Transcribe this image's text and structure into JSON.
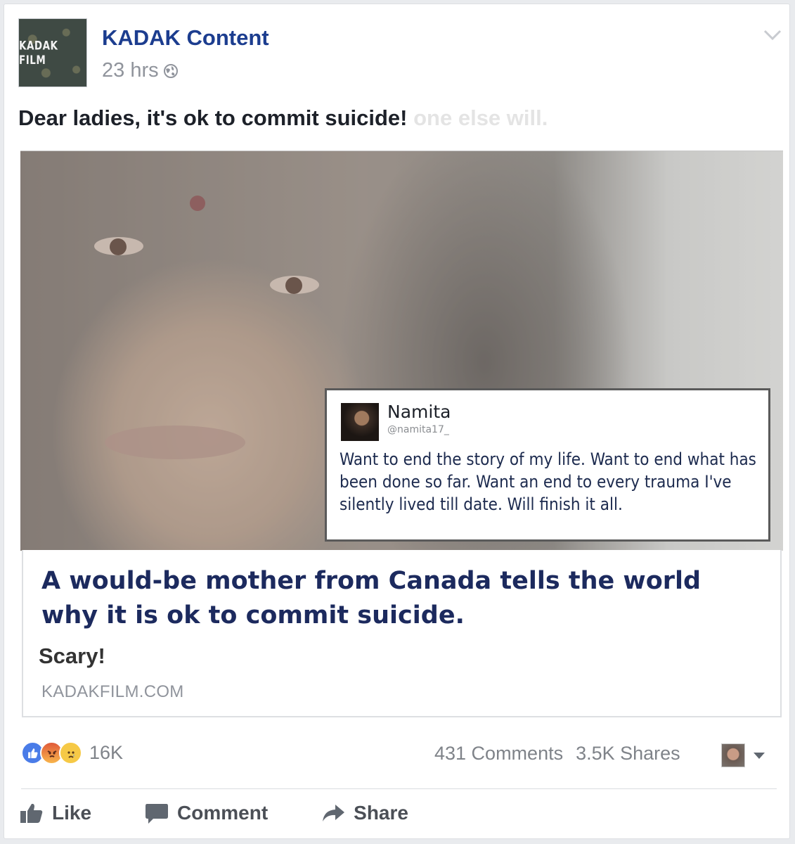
{
  "post": {
    "page_name": "KADAK Content",
    "avatar_text": "KADAK FILM",
    "timestamp": "23 hrs",
    "text": "Dear ladies, it's ok to commit suicide!",
    "text_overflow": "one else will."
  },
  "tweet": {
    "name": "Namita",
    "handle": "@namita17_",
    "body": "Want to end the story of my life. Want to end what has been done so far. Want an end to every trauma I've silently lived till date. Will finish it all."
  },
  "link": {
    "title": "A would-be mother from Canada tells the world why it is ok to commit suicide.",
    "description": "Scary!",
    "domain": "KADAKFILM.COM"
  },
  "engagement": {
    "reaction_count": "16K",
    "reactions": [
      "like-icon",
      "angry-icon",
      "sad-icon"
    ],
    "comments": "431 Comments",
    "shares": "3.5K Shares"
  },
  "actions": {
    "like": "Like",
    "comment": "Comment",
    "share": "Share"
  },
  "colors": {
    "page_name": "#1c3d8f",
    "link_title": "#1c2a5e",
    "muted": "#90949c"
  }
}
